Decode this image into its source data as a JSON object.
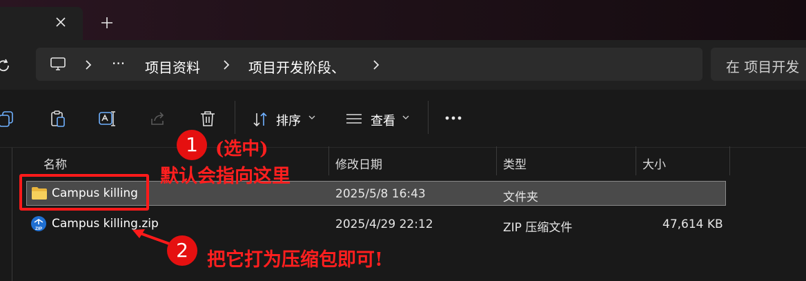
{
  "tabbar": {
    "close_icon": "close-icon",
    "new_tab_icon": "plus-icon"
  },
  "address": {
    "breadcrumbs": [
      "项目资料",
      "项目开发阶段、"
    ],
    "more": "···",
    "search_placeholder": "在 项目开发"
  },
  "toolbar": {
    "sort_label": "排序",
    "view_label": "查看",
    "more": "···"
  },
  "columns": {
    "name": "名称",
    "modified": "修改日期",
    "type": "类型",
    "size": "大小"
  },
  "files": [
    {
      "name": "Campus killing",
      "modified": "2025/5/8 16:43",
      "type": "文件夹",
      "size": "",
      "icon": "folder-icon",
      "selected": true
    },
    {
      "name": "Campus killing.zip",
      "modified": "2025/4/29 22:12",
      "type": "ZIP 压缩文件",
      "size": "47,614 KB",
      "icon": "zip-icon",
      "selected": false
    }
  ],
  "annotations": {
    "step1_number": "1",
    "step1_line1": "(选中)",
    "step1_line2": "默认会指向这里",
    "step2_number": "2",
    "step2_text": "把它打为压缩包即可!"
  },
  "colors": {
    "annotation_red": "#ff1f1f",
    "selection_bg": "#4a4a4a",
    "folder_yellow": "#f2c84b"
  }
}
